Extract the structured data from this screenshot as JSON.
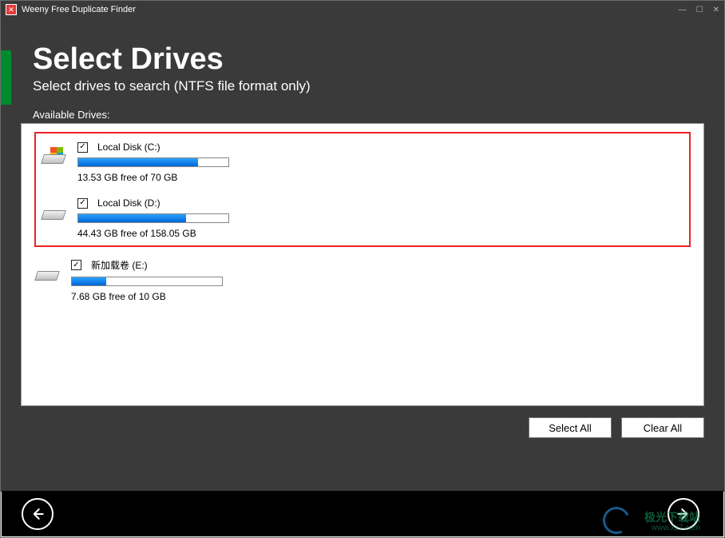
{
  "window": {
    "title": "Weeny Free Duplicate Finder"
  },
  "header": {
    "title": "Select Drives",
    "subtitle": "Select drives to search (NTFS file format only)",
    "available_label": "Available Drives:"
  },
  "drives": [
    {
      "name": "Local Disk (C:)",
      "free_text": "13.53 GB free of 70 GB",
      "checked": true,
      "used_percent": 80,
      "icon": "windows"
    },
    {
      "name": "Local Disk (D:)",
      "free_text": "44.43 GB free of 158.05 GB",
      "checked": true,
      "used_percent": 72,
      "icon": "hdd"
    },
    {
      "name": "新加载卷 (E:)",
      "free_text": "7.68 GB free of 10 GB",
      "checked": true,
      "used_percent": 23,
      "icon": "hdd"
    }
  ],
  "buttons": {
    "select_all": "Select All",
    "clear_all": "Clear All"
  },
  "watermark": {
    "cn": "极光下载站",
    "url": "www.xz7.com"
  }
}
